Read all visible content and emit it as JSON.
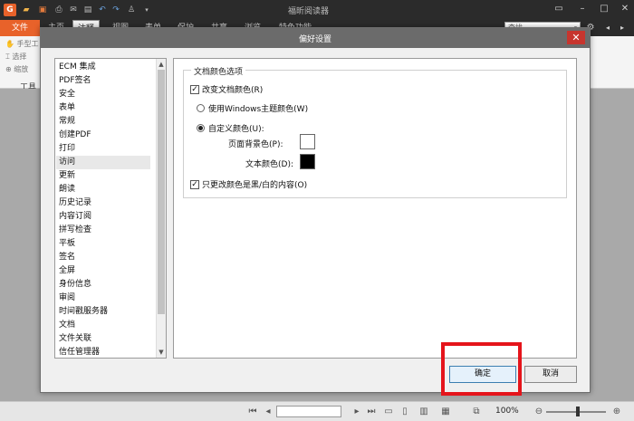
{
  "app": {
    "title": "福昕阅读器",
    "file_tab": "文件",
    "tabs": [
      "主页",
      "注释",
      "视图",
      "表单",
      "保护",
      "共享",
      "浏览",
      "特色功能"
    ],
    "active_tab_index": 1,
    "search_placeholder": "查找"
  },
  "ribbon": {
    "tool_items": [
      "手型工",
      "选择",
      "缩放"
    ],
    "group_label": "工具"
  },
  "dialog": {
    "title": "偏好设置",
    "categories": [
      "ECM 集成",
      "PDF签名",
      "安全",
      "表单",
      "常规",
      "创建PDF",
      "打印",
      "访问",
      "更新",
      "朗读",
      "历史记录",
      "内容订阅",
      "拼写检查",
      "平板",
      "签名",
      "全屏",
      "身份信息",
      "审阅",
      "时间戳服务器",
      "文档",
      "文件关联",
      "信任管理器"
    ],
    "selected_category": "访问",
    "group_title": "文档颜色选项",
    "change_doc_colors": {
      "label": "改变文档颜色(R)",
      "checked": true
    },
    "use_windows_theme": {
      "label": "使用Windows主题颜色(W)",
      "selected": false
    },
    "custom_color": {
      "label": "自定义颜色(U):",
      "selected": true
    },
    "page_bg": {
      "label": "页面背景色(P):",
      "color": "#ffffff"
    },
    "text_color": {
      "label": "文本颜色(D):",
      "color": "#000000"
    },
    "only_bw": {
      "label": "只更改颜色是黑/白的内容(O)",
      "checked": true
    },
    "ok": "确定",
    "cancel": "取消"
  },
  "status": {
    "zoom": "100%"
  },
  "colors": {
    "accent_orange": "#e8622a",
    "close_red": "#c7352e",
    "highlight_red": "#e5141b"
  }
}
